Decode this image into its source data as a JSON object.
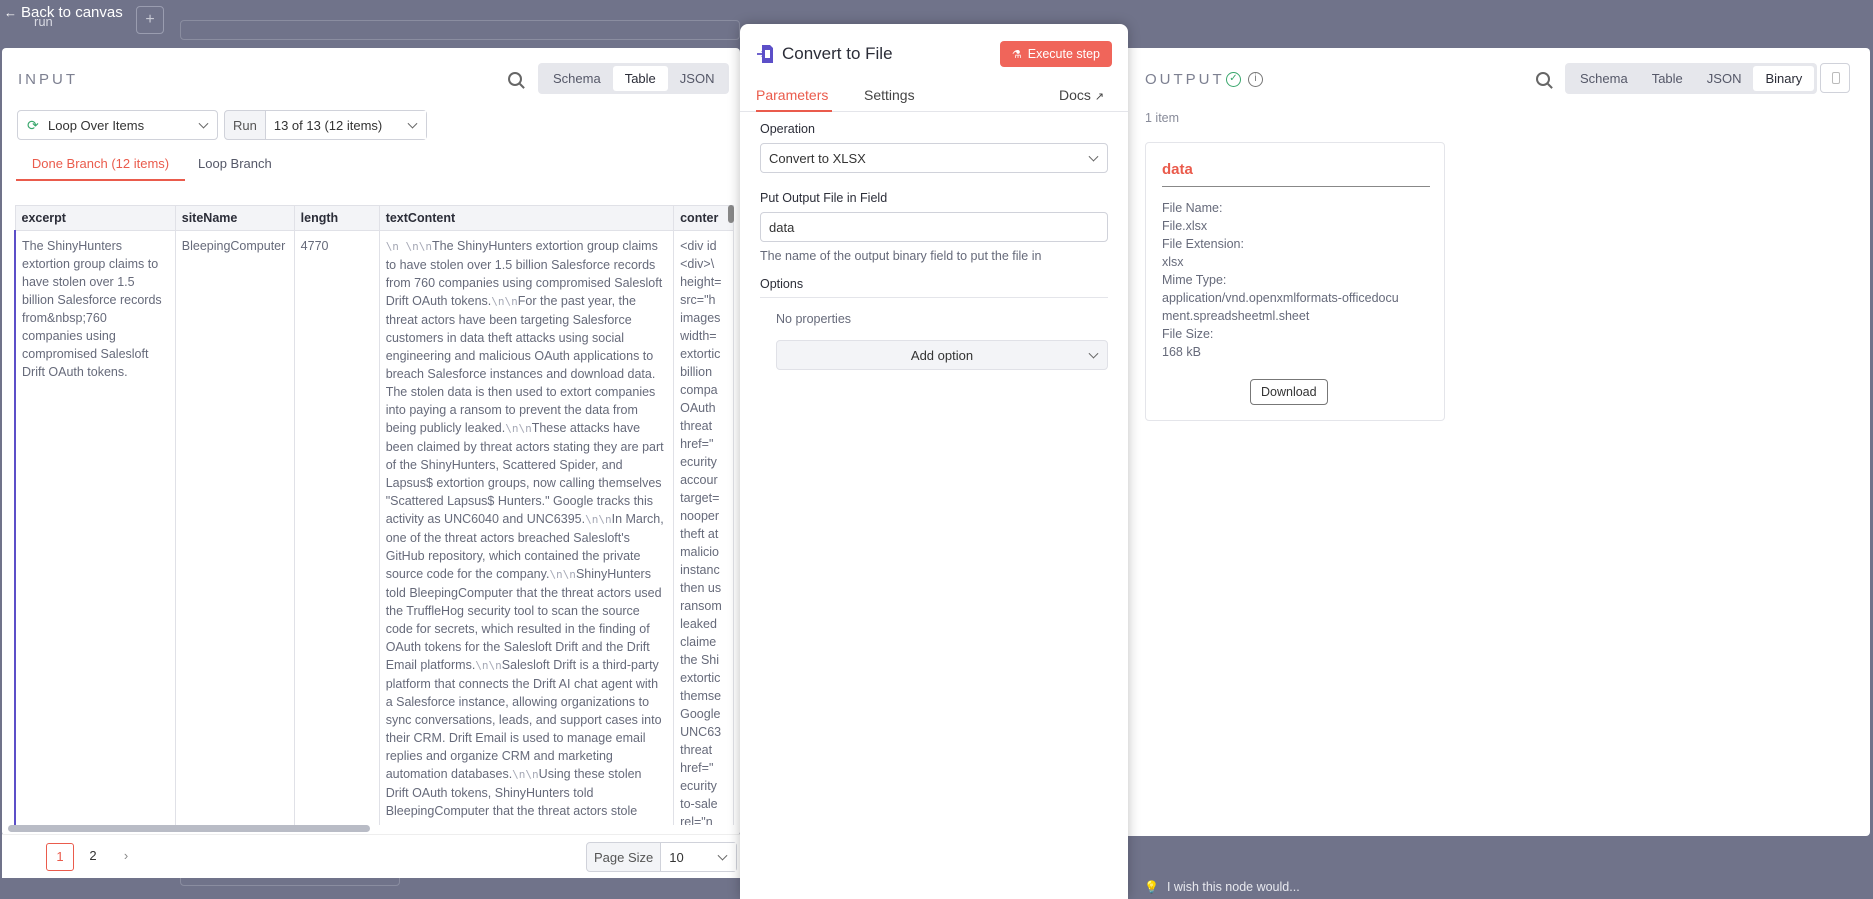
{
  "canvas": {
    "back_label": "Back to canvas",
    "node_fragment": "run",
    "plus_label": "+"
  },
  "input": {
    "label": "INPUT",
    "view_tabs": [
      "Schema",
      "Table",
      "JSON"
    ],
    "active_view": "Table",
    "source_node": "Loop Over Items",
    "run_label": "Run",
    "run_value": "13 of 13 (12 items)",
    "branches": [
      "Done Branch (12 items)",
      "Loop Branch"
    ],
    "active_branch": "Done Branch (12 items)",
    "columns": [
      "excerpt",
      "siteName",
      "length",
      "textContent",
      "conter"
    ],
    "row": {
      "excerpt": "The ShinyHunters extortion group claims to have stolen over 1.5 billion Salesforce records from&nbsp;760 companies using compromised Salesloft Drift OAuth tokens.",
      "siteName": "BleepingComputer",
      "length": "4770",
      "textContent_segments": [
        {
          "nl": "\\n    \\n\\n"
        },
        {
          "t": "The ShinyHunters extortion group claims to have stolen over 1.5 billion Salesforce records from 760 companies using compromised Salesloft Drift OAuth tokens."
        },
        {
          "nl": "\\n\\n"
        },
        {
          "t": "For the past year, the threat actors have been targeting Salesforce customers in data theft attacks using social engineering and malicious OAuth applications to breach Salesforce instances and download data. The stolen data is then used to extort companies into paying a ransom to prevent the data from being publicly leaked."
        },
        {
          "nl": "\\n\\n"
        },
        {
          "t": "These attacks have been claimed by threat actors stating they are part of the ShinyHunters, Scattered Spider, and Lapsus$ extortion groups, now calling themselves \"Scattered Lapsus$ Hunters.\" Google tracks this activity as UNC6040 and UNC6395."
        },
        {
          "nl": "\\n\\n"
        },
        {
          "t": "In March, one of the threat actors breached Salesloft's GitHub repository, which contained the private source code for the company."
        },
        {
          "nl": "\\n\\n"
        },
        {
          "t": "ShinyHunters told BleepingComputer that the threat actors used the TruffleHog security tool to scan the source code for secrets, which resulted in the finding of OAuth tokens for the Salesloft Drift and the Drift Email platforms."
        },
        {
          "nl": "\\n\\n"
        },
        {
          "t": "Salesloft Drift is a third-party platform that connects the Drift AI chat agent with a Salesforce instance, allowing organizations to sync conversations, leads, and support cases into their CRM. Drift Email is used to manage email replies and organize CRM and marketing automation databases."
        },
        {
          "nl": "\\n\\n"
        },
        {
          "t": "Using these stolen Drift OAuth tokens, ShinyHunters told BleepingComputer that the threat actors stole"
        }
      ],
      "content_lines": [
        "<div id",
        "<div>\\",
        "height=",
        "src=\"h",
        "images",
        "width=",
        "extortic",
        "billion",
        "compa",
        "OAuth",
        "threat",
        "href=\"",
        "ecurity",
        "accour",
        "target=",
        "nooper",
        "theft at",
        "malicio",
        "instanc",
        "then us",
        "ransom",
        "leaked",
        "claime",
        "the Shi",
        "extortic",
        "themse",
        "Google",
        "UNC63",
        "threat",
        "href=\"",
        "ecurity",
        "to-sale",
        "rel=\"n"
      ]
    },
    "pages": [
      "1",
      "2"
    ],
    "active_page": "1",
    "next_page": "›",
    "page_size_label": "Page Size",
    "page_size_value": "10"
  },
  "node": {
    "title": "Convert to File",
    "execute_label": "Execute step",
    "tabs": [
      "Parameters",
      "Settings"
    ],
    "active_tab": "Parameters",
    "docs_label": "Docs",
    "operation_label": "Operation",
    "operation_value": "Convert to XLSX",
    "output_field_label": "Put Output File in Field",
    "output_field_value": "data",
    "output_field_hint": "The name of the output binary field to put the file in",
    "options_label": "Options",
    "no_properties": "No properties",
    "add_option_label": "Add option"
  },
  "output": {
    "label": "OUTPUT",
    "view_tabs": [
      "Schema",
      "Table",
      "JSON",
      "Binary"
    ],
    "active_view": "Binary",
    "item_count": "1 item",
    "card_title": "data",
    "meta": [
      {
        "key": "File Name:",
        "value": "File.xlsx"
      },
      {
        "key": "File Extension:",
        "value": "xlsx"
      },
      {
        "key": "Mime Type:",
        "value": "application/vnd.openxmlformats-officedocument.spreadsheetml.sheet"
      },
      {
        "key": "File Size:",
        "value": "168 kB"
      }
    ],
    "download_label": "Download",
    "wish_label": "I wish this node would..."
  },
  "colors": {
    "accent": "#f0655a",
    "branch_active": "#ea5b4c",
    "row_marker": "#5c4fc8",
    "success": "#3aa76d"
  }
}
